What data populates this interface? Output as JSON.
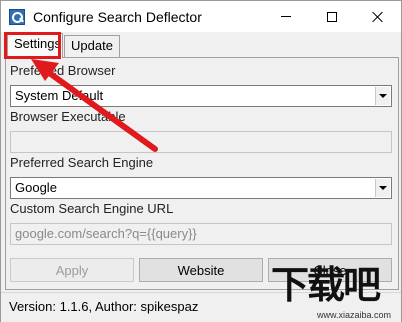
{
  "window": {
    "title": "Configure Search Deflector",
    "controls": {
      "minimize": "minimize-icon",
      "maximize": "maximize-icon",
      "close": "close-icon"
    }
  },
  "tabs": [
    {
      "label": "Settings",
      "active": true
    },
    {
      "label": "Update",
      "active": false
    }
  ],
  "settings": {
    "preferred_browser_label": "Preferred Browser",
    "preferred_browser_value": "System Default",
    "browser_executable_label": "Browser Executable",
    "browser_executable_value": "",
    "preferred_engine_label": "Preferred Search Engine",
    "preferred_engine_value": "Google",
    "custom_url_label": "Custom Search Engine URL",
    "custom_url_value": "google.com/search?q={{query}}"
  },
  "buttons": {
    "apply": "Apply",
    "website": "Website",
    "close": "Close"
  },
  "status": {
    "text": "Version: 1.1.6, Author: spikespaz"
  },
  "annotation": {
    "highlight_color": "#e0191c"
  },
  "watermark": {
    "logo": "下载吧",
    "url": "www.xiazaiba.com"
  }
}
